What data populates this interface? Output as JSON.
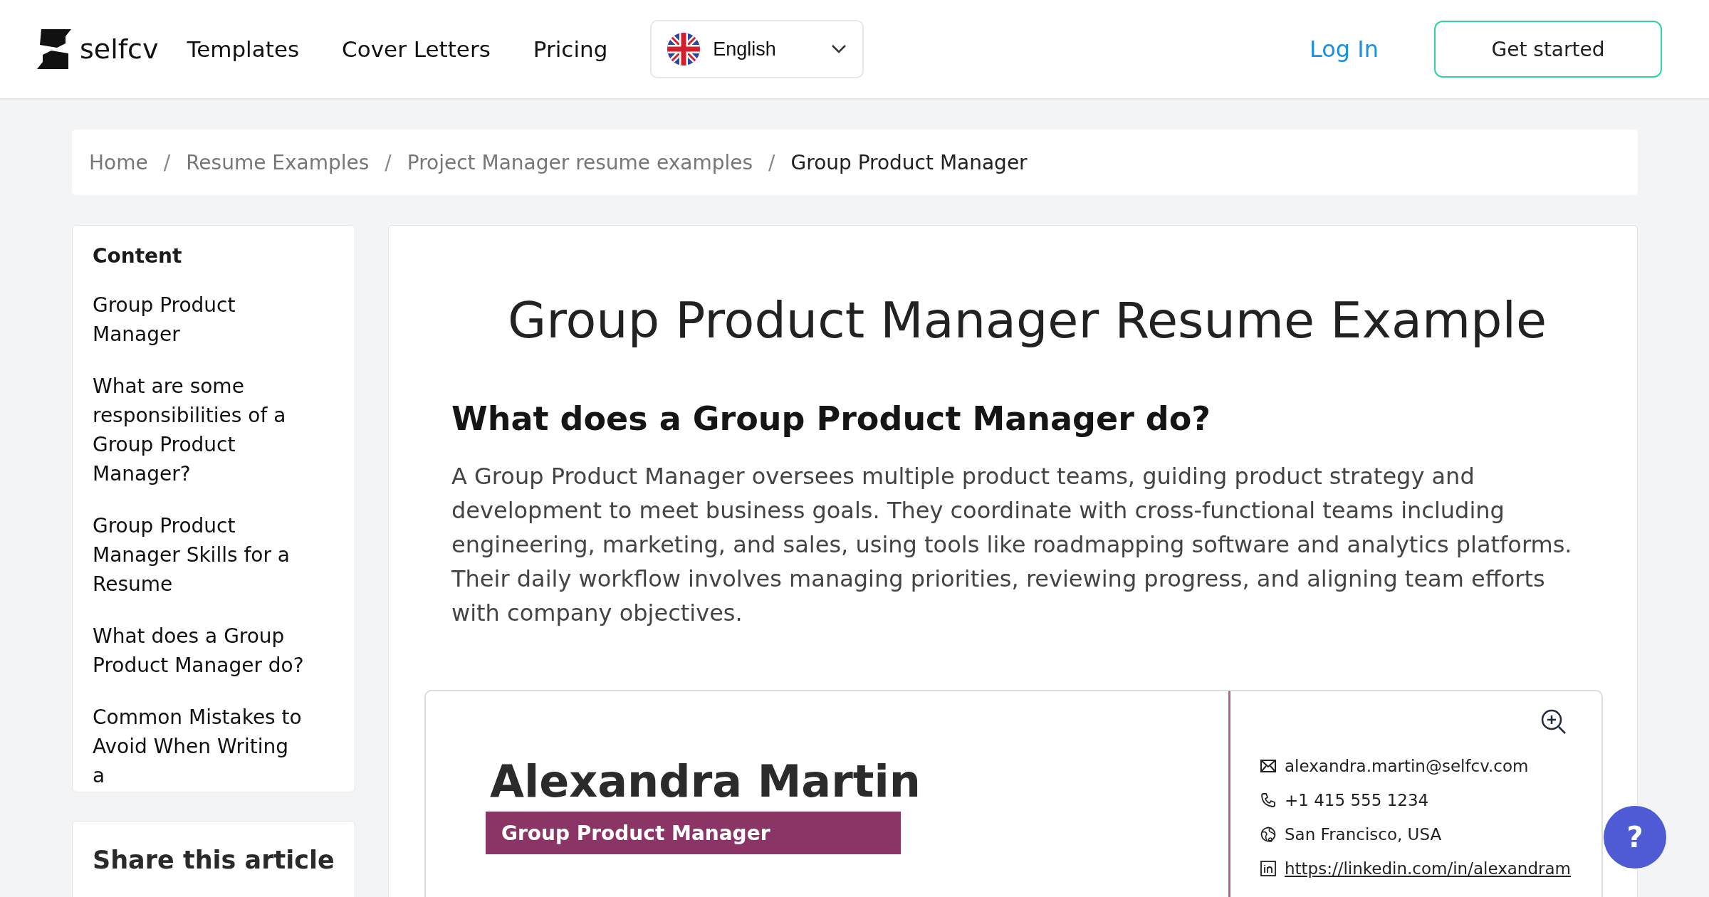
{
  "header": {
    "logo": "selfcv",
    "nav": [
      "Templates",
      "Cover Letters",
      "Pricing"
    ],
    "language": {
      "label": "English"
    },
    "login": "Log In",
    "cta": "Get started"
  },
  "breadcrumb": [
    {
      "label": "Home",
      "current": false
    },
    {
      "label": "Resume Examples",
      "current": false
    },
    {
      "label": "Project Manager resume examples",
      "current": false
    },
    {
      "label": "Group Product Manager",
      "current": true
    }
  ],
  "separator": "/",
  "toc": {
    "title": "Content",
    "items": [
      "Group Product Manager",
      "What are some responsibilities of a Group Product Manager?",
      "Group Product Manager Skills for a Resume",
      "What does a Group Product Manager do?",
      "Common Mistakes to Avoid When Writing a"
    ]
  },
  "share": {
    "title": "Share this article"
  },
  "article": {
    "title": "Group Product Manager Resume Example",
    "heading": "What does a Group Product Manager do?",
    "paragraph": "A Group Product Manager oversees multiple product teams, guiding product strategy and development to meet business goals. They coordinate with cross-functional teams including engineering, marketing, and sales, using tools like roadmapping software and analytics platforms. Their daily workflow involves managing priorities, reviewing progress, and aligning team efforts with company objectives."
  },
  "resume": {
    "name": "Alexandra Martin",
    "role": "Group Product Manager",
    "contacts": [
      {
        "kind": "email",
        "text": "alexandra.martin@selfcv.com"
      },
      {
        "kind": "phone",
        "text": "+1 415 555 1234"
      },
      {
        "kind": "location",
        "text": "San Francisco, USA"
      },
      {
        "kind": "linkedin",
        "text": "https://linkedin.com/in/alexandram"
      }
    ]
  },
  "help_button": {
    "label": "?"
  }
}
